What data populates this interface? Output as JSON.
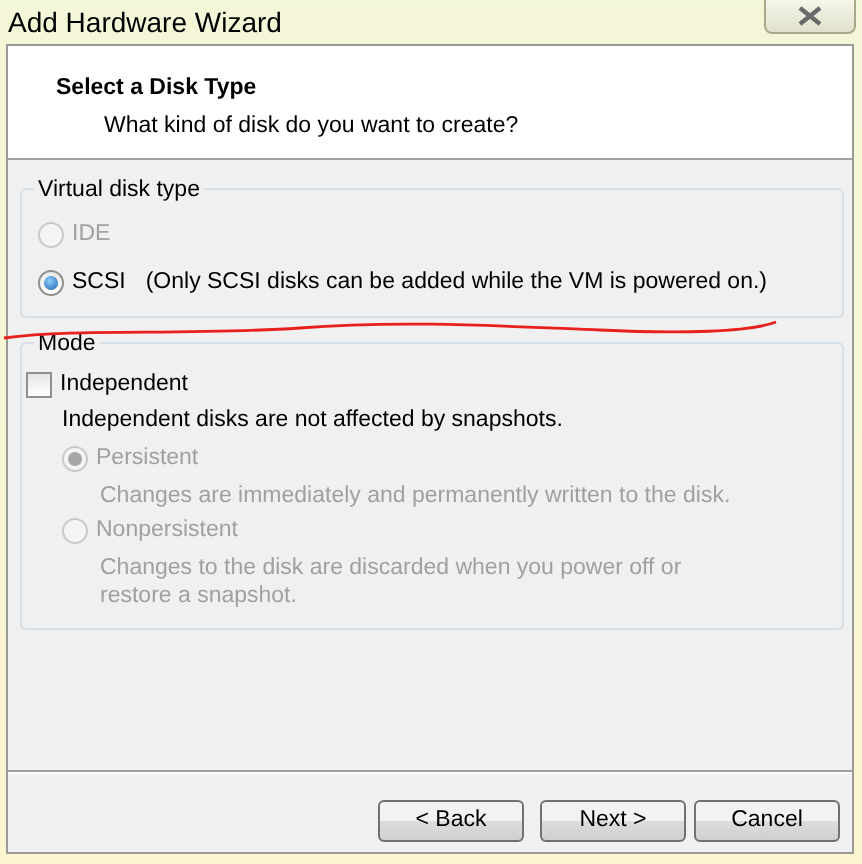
{
  "window": {
    "title": "Add Hardware Wizard"
  },
  "header": {
    "title": "Select a Disk Type",
    "subtitle": "What kind of disk do you want to create?"
  },
  "disk_type": {
    "label": "Virtual disk type",
    "options": [
      {
        "label": "IDE",
        "selected": false,
        "disabled": true
      },
      {
        "label": "SCSI",
        "selected": true,
        "disabled": false,
        "note": "(Only SCSI disks can be added while the VM is powered on.)"
      }
    ]
  },
  "mode": {
    "label": "Mode",
    "independent": {
      "label": "Independent",
      "checked": false
    },
    "description": "Independent disks are not affected by snapshots.",
    "options": [
      {
        "label": "Persistent",
        "selected": true,
        "disabled": true,
        "description": "Changes are immediately and permanently written to the disk."
      },
      {
        "label": "Nonpersistent",
        "selected": false,
        "disabled": true,
        "description": "Changes to the disk are discarded when you power off or restore a snapshot."
      }
    ]
  },
  "buttons": [
    {
      "label": "< Back"
    },
    {
      "label": "Next >"
    },
    {
      "label": "Cancel"
    }
  ]
}
